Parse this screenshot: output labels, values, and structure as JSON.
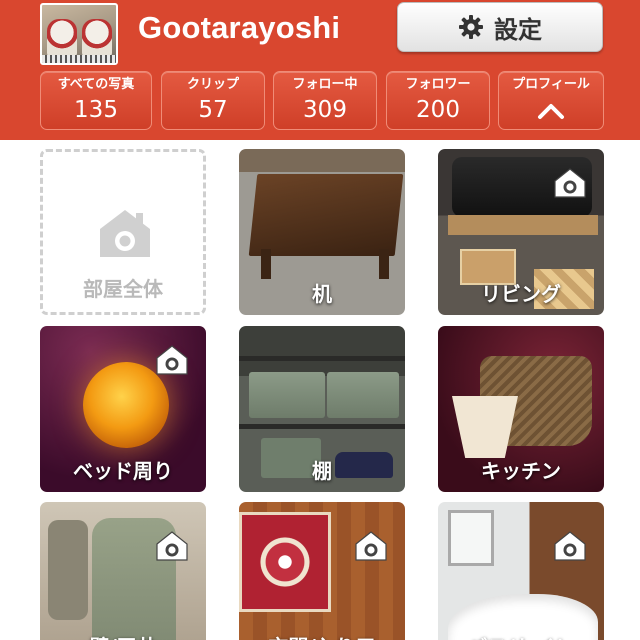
{
  "header": {
    "username": "Gootarayoshi",
    "settings_label": "設定",
    "accent_color": "#d9472f"
  },
  "stats": [
    {
      "label": "すべての写真",
      "value": "135"
    },
    {
      "label": "クリップ",
      "value": "57"
    },
    {
      "label": "フォロー中",
      "value": "309"
    },
    {
      "label": "フォロワー",
      "value": "200"
    },
    {
      "label": "プロフィール",
      "icon": "chevron-up-icon"
    }
  ],
  "grid": {
    "tiles": [
      {
        "label": "部屋全体",
        "type": "empty-placeholder",
        "icon": "house-camera-icon"
      },
      {
        "label": "机",
        "type": "photo"
      },
      {
        "label": "リビング",
        "type": "photo",
        "icon": "house-camera-icon"
      },
      {
        "label": "ベッド周り",
        "type": "photo",
        "icon": "house-camera-icon"
      },
      {
        "label": "棚",
        "type": "photo"
      },
      {
        "label": "キッチン",
        "type": "photo"
      },
      {
        "label": "壁/天井",
        "type": "photo",
        "icon": "house-camera-icon"
      },
      {
        "label": "玄関/入り口",
        "type": "photo",
        "icon": "house-camera-icon"
      },
      {
        "label": "バス/トイレ",
        "type": "photo",
        "icon": "house-camera-icon"
      }
    ]
  }
}
